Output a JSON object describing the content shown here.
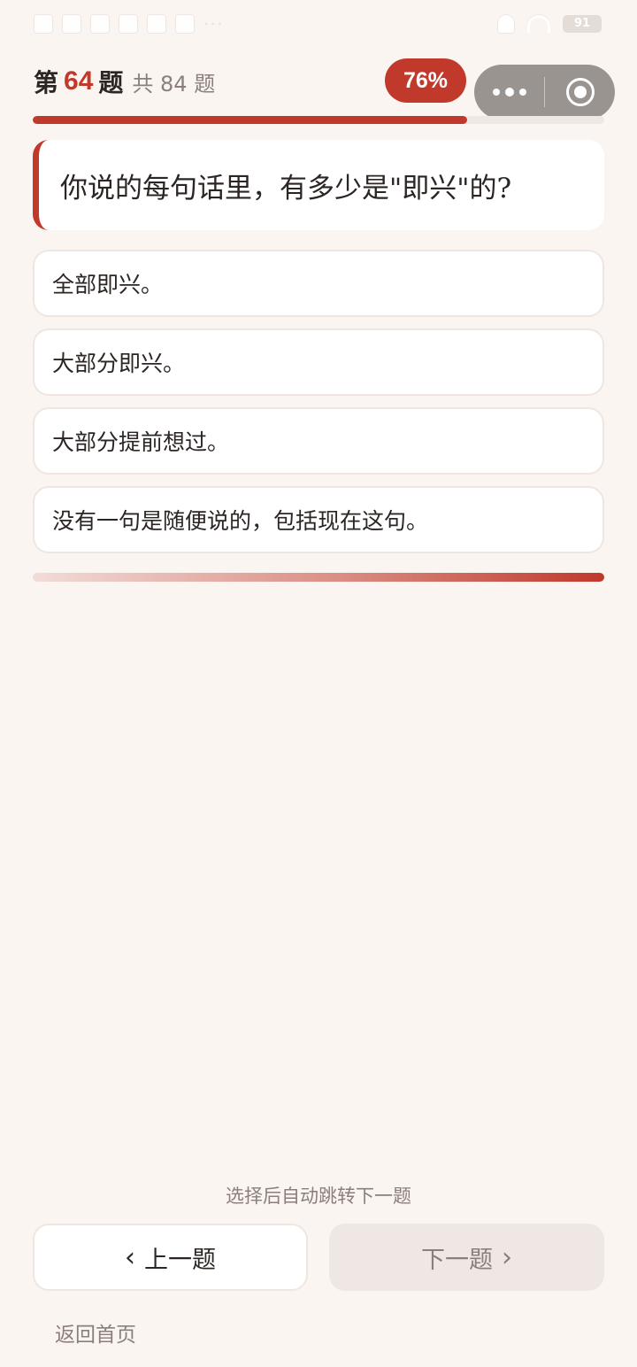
{
  "status_bar": {
    "left_icons": [
      "notification-icon",
      "app-icon",
      "cloud-icon",
      "message-icon",
      "mail-icon",
      "crown-icon"
    ],
    "more": "···",
    "battery": "91"
  },
  "header": {
    "prefix": "第",
    "current": "64",
    "suffix": "题",
    "total": "共 84 题",
    "percent": "76%",
    "progress_percent": 76
  },
  "question": {
    "text": "你说的每句话里，有多少是\"即兴\"的?"
  },
  "options": [
    {
      "label": "全部即兴。"
    },
    {
      "label": "大部分即兴。"
    },
    {
      "label": "大部分提前想过。"
    },
    {
      "label": "没有一句是随便说的，包括现在这句。"
    }
  ],
  "footer": {
    "hint": "选择后自动跳转下一题",
    "prev_label": "上一题",
    "prev_chevron": "‹",
    "next_label": "下一题",
    "next_chevron": "›",
    "home_label": "返回首页"
  },
  "colors": {
    "accent": "#c0392b",
    "background": "#fbf5f1",
    "muted_text": "#8a7f7a"
  }
}
